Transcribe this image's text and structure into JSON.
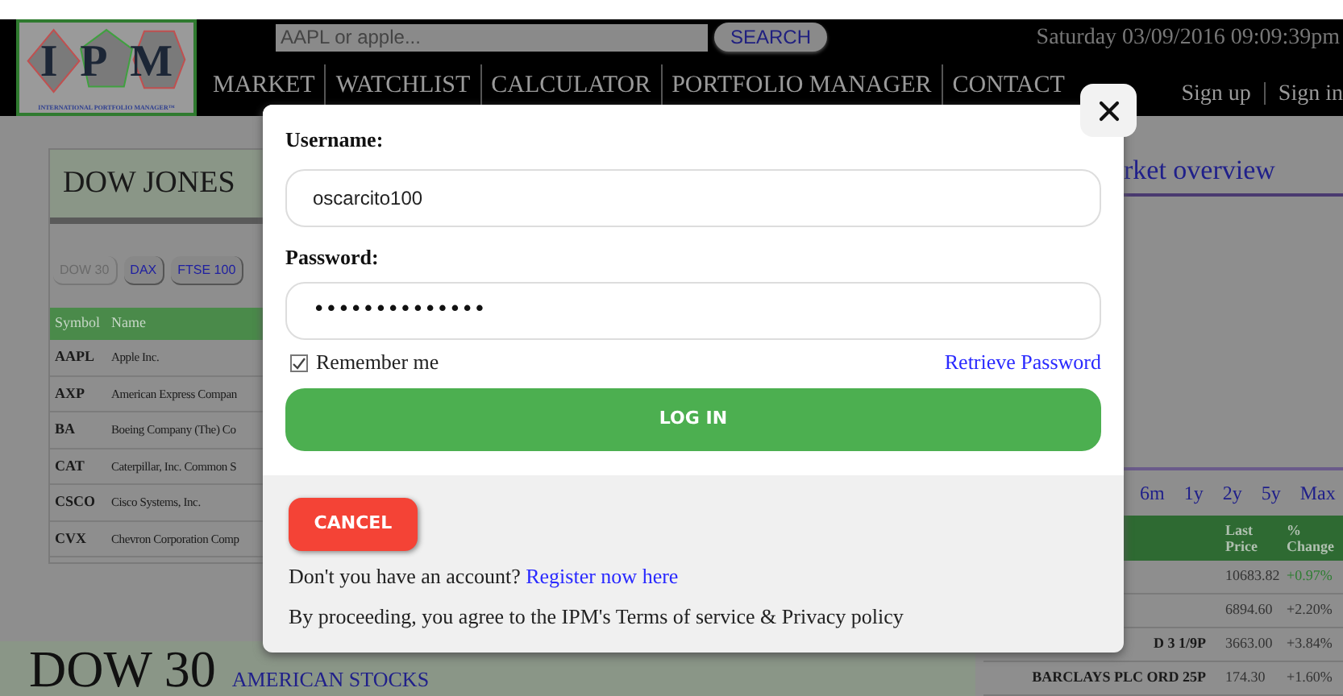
{
  "header": {
    "logo": {
      "letters": [
        "I",
        "P",
        "M"
      ],
      "tagline": "INTERNATIONAL PORTFOLIO MANAGER™"
    },
    "search": {
      "placeholder": "AAPL or apple...",
      "button": "SEARCH"
    },
    "datetime": "Saturday 03/09/2016 09:09:39pm",
    "nav": [
      "MARKET",
      "WATCHLIST",
      "CALCULATOR",
      "PORTFOLIO MANAGER",
      "CONTACT"
    ],
    "account_links": [
      "Sign up",
      "Sign in"
    ]
  },
  "left_panel": {
    "title": "DOW JONES",
    "tabs": [
      {
        "label": "DOW 30",
        "selected": true
      },
      {
        "label": "DAX",
        "selected": false
      },
      {
        "label": "FTSE 100",
        "selected": false
      }
    ],
    "table": {
      "columns": [
        "Symbol",
        "Name"
      ],
      "rows": [
        {
          "symbol": "AAPL",
          "name": "Apple Inc."
        },
        {
          "symbol": "AXP",
          "name": "American Express Compan"
        },
        {
          "symbol": "BA",
          "name": "Boeing Company (The) Co"
        },
        {
          "symbol": "CAT",
          "name": "Caterpillar, Inc. Common S"
        },
        {
          "symbol": "CSCO",
          "name": "Cisco Systems, Inc."
        },
        {
          "symbol": "CVX",
          "name": "Chevron Corporation Comp"
        }
      ]
    }
  },
  "right_panel": {
    "title": "rket overview",
    "ranges": [
      "6m",
      "1y",
      "2y",
      "5y",
      "Max"
    ],
    "table": {
      "columns": [
        "Last Price",
        "% Change"
      ],
      "rows": [
        {
          "column_1": "",
          "last_price": "10683.82",
          "change": "+0.97%",
          "color": "#2e7d32"
        },
        {
          "column_1": "",
          "last_price": "6894.60",
          "change": "+2.20%",
          "color": "#333333"
        },
        {
          "column_1": "D 3 1/9P",
          "last_price": "3663.00",
          "change": "+3.84%",
          "color": "#333333"
        },
        {
          "column_1": "BARCLAYS PLC ORD 25P",
          "last_price": "174.30",
          "change": "+1.60%",
          "color": "#333333"
        }
      ]
    }
  },
  "footer": {
    "title": "DOW 30",
    "subtitle": "AMERICAN STOCKS"
  },
  "login_dialog": {
    "username_label": "Username:",
    "username": "oscarcito100",
    "password_label": "Password:",
    "password": "••••••••••••••",
    "remember": {
      "label": "Remember me",
      "checked": true
    },
    "retrieve_link": "Retrieve Password",
    "login_button": "LOG IN",
    "cancel_button": "CANCEL",
    "register_prompt": "Don't you have an account?",
    "register_link": "Register now here",
    "terms": "By proceeding, you agree to the IPM's Terms of service & Privacy policy"
  }
}
